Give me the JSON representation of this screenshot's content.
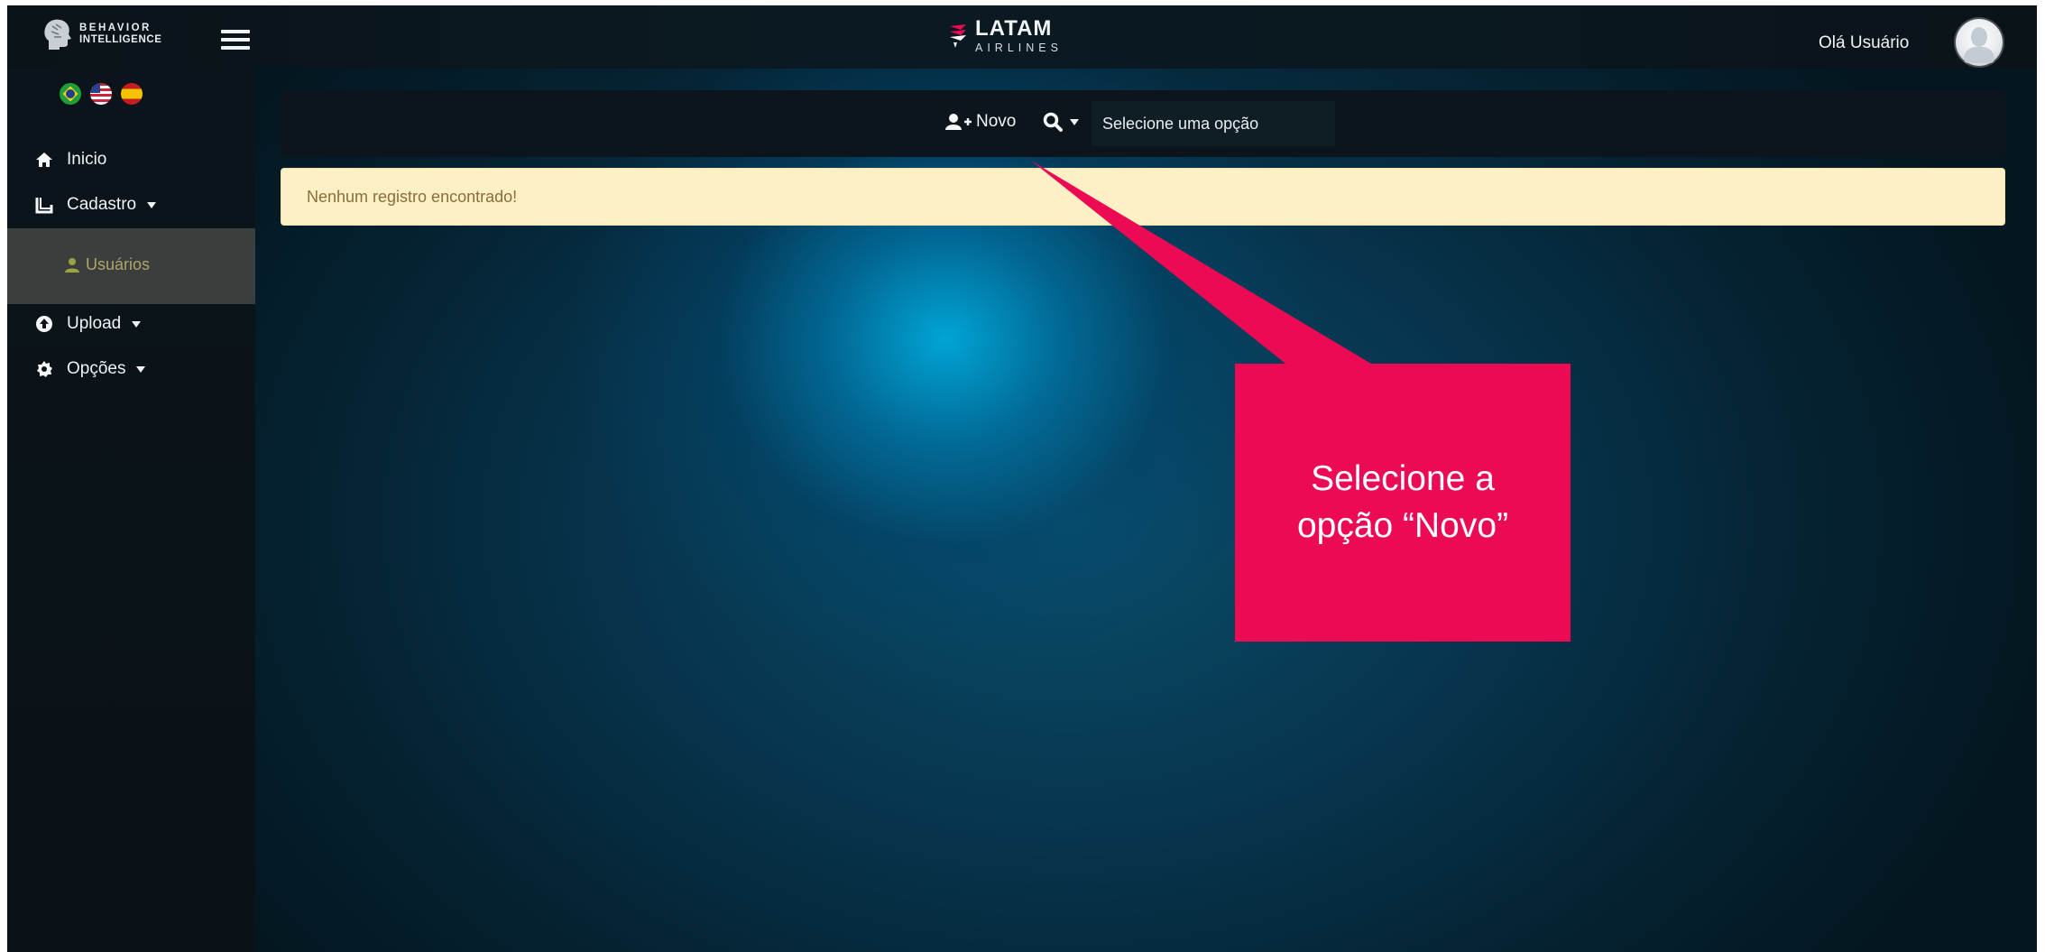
{
  "brand": {
    "line1": "BEHAVIOR",
    "line2": "INTELLIGENCE",
    "logo_icon": "head-profile-icon"
  },
  "header": {
    "airline_name": "LATAM",
    "airline_sub": "AIRLINES",
    "greeting": "Olá Usuário",
    "menu_icon": "hamburger-icon",
    "avatar_icon": "user-avatar-icon"
  },
  "languages": [
    "Português",
    "English",
    "Español"
  ],
  "sidebar": {
    "items": [
      {
        "label": "Inicio",
        "icon": "home-icon"
      },
      {
        "label": "Cadastro",
        "icon": "book-icon",
        "has_dropdown": true
      },
      {
        "label": "Upload",
        "icon": "upload-icon",
        "has_dropdown": true
      },
      {
        "label": "Opções",
        "icon": "gear-icon",
        "has_dropdown": true
      }
    ],
    "submenu": {
      "label": "Usuários",
      "icon": "user-icon"
    }
  },
  "toolbar": {
    "new_label": "Novo",
    "new_icon": "user-plus-icon",
    "search_icon": "search-icon",
    "select_placeholder": "Selecione uma opção"
  },
  "alert": {
    "message": "Nenhum registro encontrado!"
  },
  "callout": {
    "line1": "Selecione a",
    "line2": "opção “Novo”"
  },
  "colors": {
    "callout": "#ec0a55",
    "alert_bg": "#fcf0c4",
    "alert_text": "#8a6d3b",
    "submenu_bg": "#3a3f3e",
    "submenu_text": "#b0a567"
  }
}
